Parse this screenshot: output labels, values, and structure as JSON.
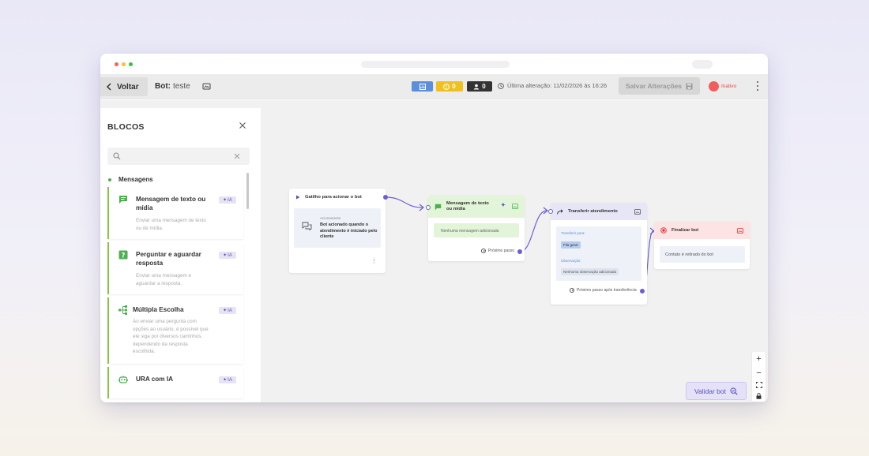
{
  "toolbar": {
    "back_label": "Voltar",
    "bot_prefix": "Bot:",
    "bot_name": "teste",
    "alerts_count": "0",
    "users_count": "0",
    "last_edit": "Última alteração: 11/02/2026 às 16:26",
    "save_label": "Salvar Alterações",
    "status_label": "Inativo"
  },
  "panel": {
    "title": "BLOCOS",
    "search_placeholder": "",
    "category": "Mensagens",
    "ia_label": "IA",
    "blocks": [
      {
        "title": "Mensagem de texto ou mídia",
        "description": "Enviar uma mensagem de texto ou de mídia.",
        "icon": "chat-bubble-icon"
      },
      {
        "title": "Perguntar e aguardar resposta",
        "description": "Enviar uma mensagem e aguardar a resposta.",
        "icon": "question-icon"
      },
      {
        "title": "Múltipla Escolha",
        "description": "Ao enviar uma pergunta com opções ao usuário, é possível que ele siga por diversos caminhos, dependendo da resposta escolhida.",
        "icon": "branch-icon"
      },
      {
        "title": "URA com IA",
        "description": "",
        "icon": "robot-icon"
      }
    ]
  },
  "flow": {
    "trigger": {
      "title": "Gatilho para acionar o bot",
      "label": "Acionamento",
      "text": "Bot acionado quando o atendimento é iniciado pelo cliente"
    },
    "message": {
      "title": "Mensagem de texto ou mídia",
      "empty": "Nenhuma mensagem adicionada",
      "next": "Próximo passo"
    },
    "transfer": {
      "title": "Transferir atendimento",
      "transfer_label": "Transferir para:",
      "queue": "Fila geral",
      "obs_label": "Observação:",
      "obs_value": "Nenhuma observação adicionada",
      "next": "Próximo passo após transferência"
    },
    "end": {
      "title": "Finalizar bot",
      "text": "Contato é retirado do bot"
    }
  },
  "controls": {
    "validate_label": "Validar bot",
    "zoom_in": "+",
    "zoom_out": "−"
  },
  "colors": {
    "accent": "#6c5ed6",
    "block_border": "#8bc34a",
    "message_header": "#e3f5d8",
    "transfer_header": "#e6e6f6",
    "end_header": "#fde3e3",
    "status": "#f25c5c"
  }
}
